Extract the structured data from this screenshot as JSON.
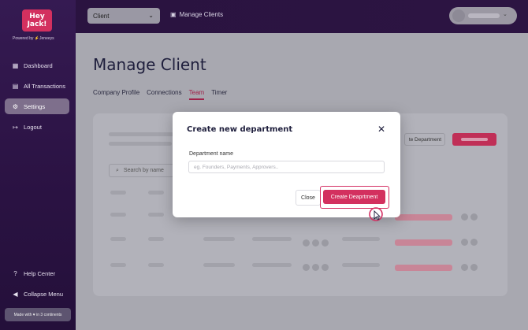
{
  "brand": {
    "logo_line1": "Hey",
    "logo_line2": "Jack!",
    "powered_by": "Powered by ⚡Jeneeys"
  },
  "sidebar": {
    "items": [
      {
        "label": "Dashboard",
        "icon": "dashboard-icon"
      },
      {
        "label": "All Transactions",
        "icon": "transactions-icon"
      },
      {
        "label": "Settings",
        "icon": "gear-icon",
        "active": true
      },
      {
        "label": "Logout",
        "icon": "logout-icon"
      }
    ],
    "help_center": "Help Center",
    "collapse_menu": "Collapse Menu",
    "made_with": "Made with ♥ in 3 continents"
  },
  "topbar": {
    "client_select_value": "Client",
    "manage_clients_label": "Manage Clients"
  },
  "page": {
    "title": "Manage Client",
    "tabs": [
      {
        "label": "Company Profile"
      },
      {
        "label": "Connections"
      },
      {
        "label": "Team",
        "active": true
      },
      {
        "label": "Timer"
      }
    ]
  },
  "card": {
    "outline_button_label": "te Department",
    "search_placeholder": "Search by name"
  },
  "modal": {
    "title": "Create new department",
    "field_label": "Department name",
    "field_placeholder": "eg. Founders, Payments, Approvers..",
    "close_label": "Close",
    "create_label": "Create Deaprtment"
  },
  "colors": {
    "brand": "#d3305f",
    "sidebar": "#2a1242",
    "active_tab": "#a02149"
  }
}
